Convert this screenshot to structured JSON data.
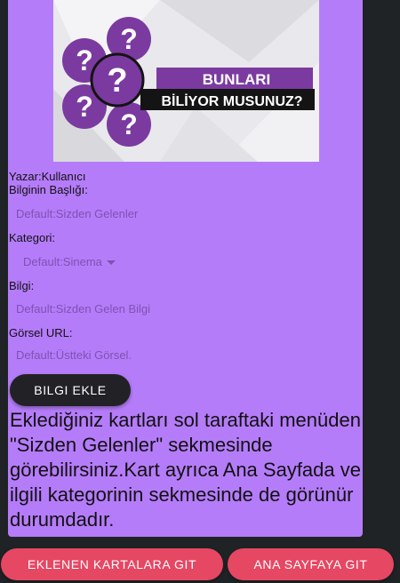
{
  "banner": {
    "line1": "BUNLARI",
    "line2": "BİLİYOR MUSUNUZ?"
  },
  "form": {
    "author": "Yazar:Kullanıcı",
    "title_label": "Bilginin Başlığı:",
    "title_placeholder": "Default:Sizden Gelenler",
    "category_label": "Kategori:",
    "category_value": "Default:Sinema",
    "info_label": "Bilgi:",
    "info_placeholder": "Default:Sizden Gelen Bilgi",
    "image_label": "Görsel URL:",
    "image_placeholder": "Default:Üstteki Görsel.",
    "submit_label": "BILGI EKLE"
  },
  "info_text": "Eklediğiniz kartları sol taraftaki menüden \"Sizden Gelenler\" sekmesinde görebilirsiniz.Kart ayrıca Ana Sayfada ve ilgili kategorinin sekmesinde de görünür durumdadır.",
  "footer": {
    "cards_button": "EKLENEN KARTALARA GIT",
    "home_button": "ANA SAYFAYA GIT"
  },
  "colors": {
    "card": "#b57cfa",
    "background": "#202325",
    "accent": "#e64763",
    "question_mark": "#7b3aa0"
  }
}
